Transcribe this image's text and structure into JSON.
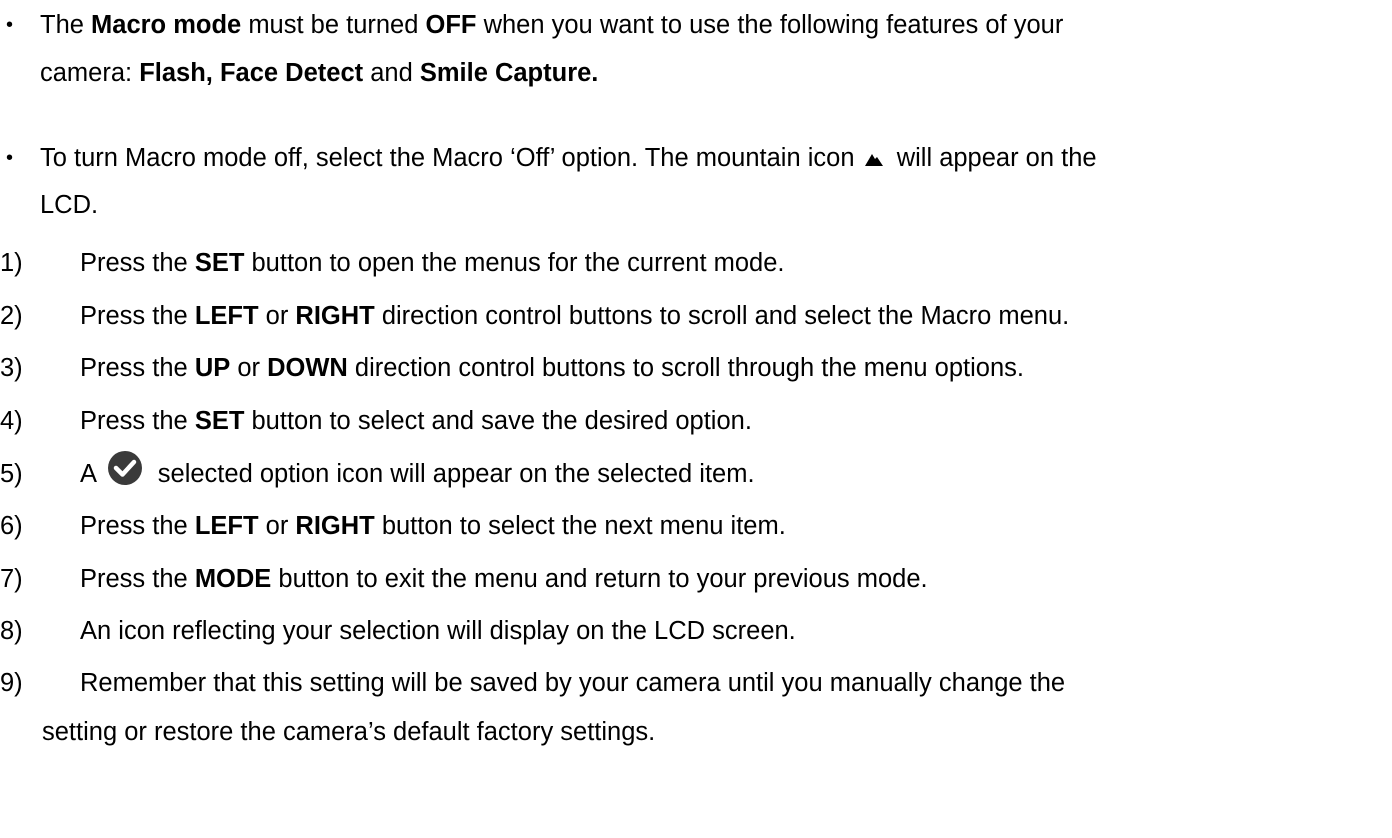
{
  "bullets": [
    {
      "lines": [
        [
          "The ",
          {
            "b": "Macro mode"
          },
          " must be turned ",
          {
            "b": "OFF"
          },
          " when you want to use the following features of your"
        ],
        [
          "camera:   ",
          {
            "b": "Flash, Face Detect"
          },
          " and ",
          {
            "b": "Smile Capture."
          }
        ]
      ]
    },
    {
      "lines": [
        [
          "To turn Macro mode off, select the Macro ‘Off’ option. The mountain icon ",
          {
            "icon": "mountain-icon"
          },
          " will appear on the"
        ],
        [
          "LCD."
        ]
      ]
    }
  ],
  "steps": [
    {
      "num": "1)",
      "lines": [
        [
          "Press the ",
          {
            "b": "SET"
          },
          " button to open the menus for the current mode."
        ]
      ]
    },
    {
      "num": "2)",
      "lines": [
        [
          "Press the ",
          {
            "b": "LEFT"
          },
          " or ",
          {
            "b": "RIGHT"
          },
          " direction control buttons to scroll and select the Macro menu."
        ]
      ]
    },
    {
      "num": "3)",
      "lines": [
        [
          "Press the ",
          {
            "b": "UP"
          },
          " or ",
          {
            "b": "DOWN"
          },
          " direction control buttons to scroll through the menu options."
        ]
      ]
    },
    {
      "num": "4)",
      "lines": [
        [
          "Press the ",
          {
            "b": "SET"
          },
          " button to select and save the desired option."
        ]
      ]
    },
    {
      "num": "5)",
      "lines": [
        [
          "A ",
          {
            "icon": "check-circle-icon"
          },
          " selected option icon will appear on the selected item."
        ]
      ]
    },
    {
      "num": "6)",
      "lines": [
        [
          "Press the ",
          {
            "b": "LEFT"
          },
          " or ",
          {
            "b": "RIGHT"
          },
          " button to select the next menu item."
        ]
      ]
    },
    {
      "num": "7)",
      "lines": [
        [
          "Press the ",
          {
            "b": "MODE"
          },
          " button to exit the menu and return to your previous mode."
        ]
      ]
    },
    {
      "num": "8)",
      "lines": [
        [
          "An icon reflecting your selection will display on the LCD screen."
        ]
      ]
    },
    {
      "num": "9)",
      "lines": [
        [
          "Remember that this setting will be saved by your camera until you manually change the"
        ],
        [
          "setting or restore the camera’s default factory settings."
        ]
      ]
    }
  ]
}
